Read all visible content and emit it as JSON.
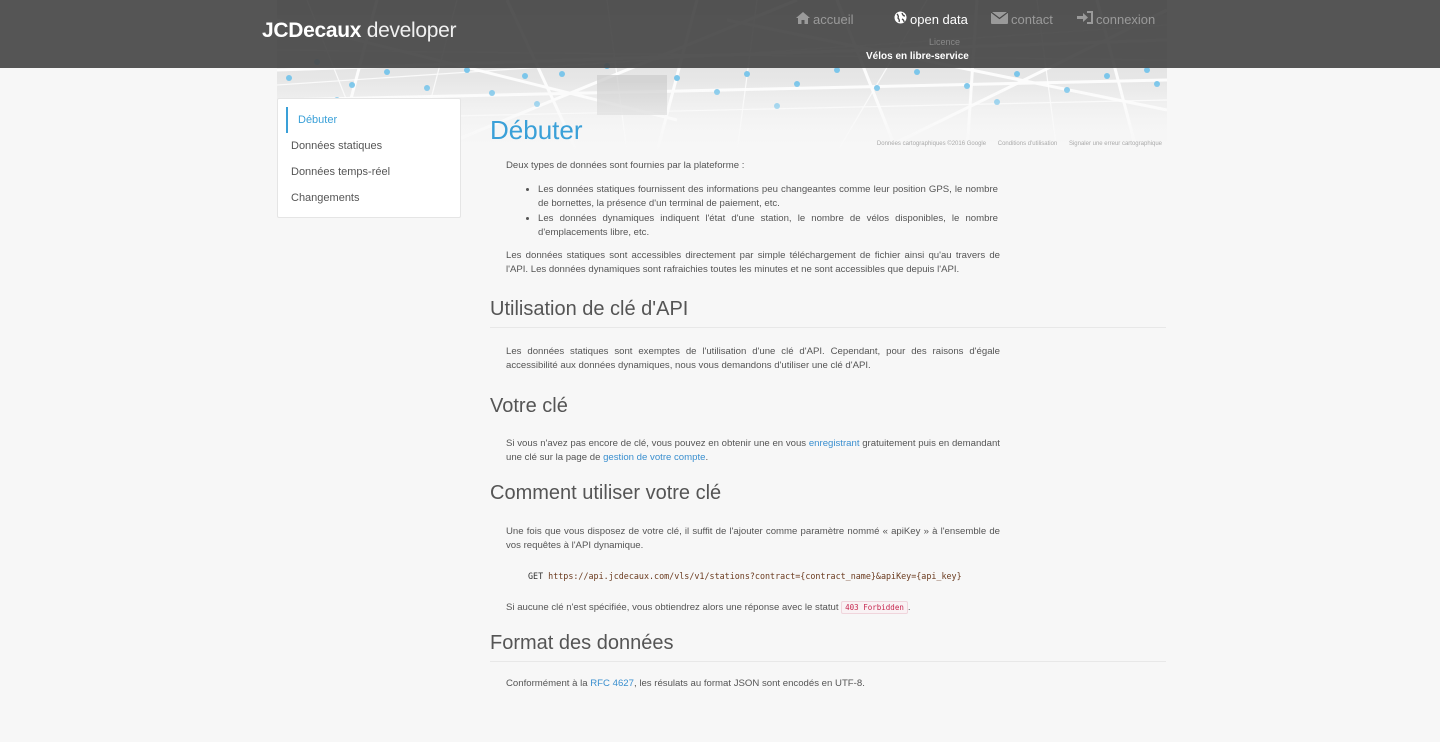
{
  "header": {
    "brand_bold": "JCDecaux",
    "brand_light": " developer",
    "nav": {
      "accueil": "accueil",
      "open_data": "open data",
      "contact": "contact",
      "connexion": "connexion"
    },
    "sub_licence": "Licence",
    "sub_velos": "Vélos en libre-service"
  },
  "map": {
    "attribution": [
      "Données cartographiques ©2016 Google",
      "Conditions d'utilisation",
      "Signaler une erreur cartographique"
    ]
  },
  "sidebar": {
    "items": [
      {
        "label": "Débuter",
        "active": true
      },
      {
        "label": "Données statiques"
      },
      {
        "label": "Données temps-réel"
      },
      {
        "label": "Changements"
      }
    ]
  },
  "content": {
    "title": "Débuter",
    "intro": "Deux types de données sont fournies par la plateforme :",
    "bullets": [
      "Les données statiques fournissent des informations peu changeantes comme leur position GPS, le nombre de bornettes, la présence d'un terminal de paiement, etc.",
      "Les données dynamiques indiquent l'état d'une station, le nombre de vélos disponibles, le nombre d'emplacements libre, etc."
    ],
    "para_access": "Les données statiques sont accessibles directement par simple téléchargement de fichier ainsi qu'au travers de l'API. Les données dynamiques sont rafraichies toutes les minutes et ne sont accessibles que depuis l'API.",
    "sections": {
      "cle_api": {
        "heading": "Utilisation de clé d'API",
        "text": "Les données statiques sont exemptes de l'utilisation d'une clé d'API. Cependant, pour des raisons d'égale accessibilité aux données dynamiques, nous vous demandons d'utiliser une clé d'API."
      },
      "votre_cle": {
        "heading": "Votre clé",
        "text_1": "Si vous n'avez pas encore de clé, vous pouvez en obtenir une en vous ",
        "link_1": "enregistrant",
        "text_2": " gratuitement puis en demandant une clé sur la page de ",
        "link_2": "gestion de votre compte",
        "text_3": "."
      },
      "comment": {
        "heading": "Comment utiliser votre clé",
        "text": "Une fois que vous disposez de votre clé, il suffit de l'ajouter comme paramètre nommé « apiKey » à l'ensemble de vos requêtes à l'API dynamique.",
        "code_method": "GET ",
        "code_url": "https://api.jcdecaux.com/vls/v1/stations?contract={contract_name}&apiKey={api_key}",
        "no_key_1": "Si aucune clé n'est spécifiée, vous obtiendrez alors une réponse avec le statut ",
        "no_key_code": "403 Forbidden",
        "no_key_2": "."
      },
      "format": {
        "heading": "Format des données",
        "text_1": "Conformément à la ",
        "link": "RFC 4627",
        "text_2": ", les résulats au format JSON sont encodés en UTF-8."
      }
    }
  },
  "colors": {
    "accent": "#3aa0d8",
    "header_bg": "#464646"
  }
}
